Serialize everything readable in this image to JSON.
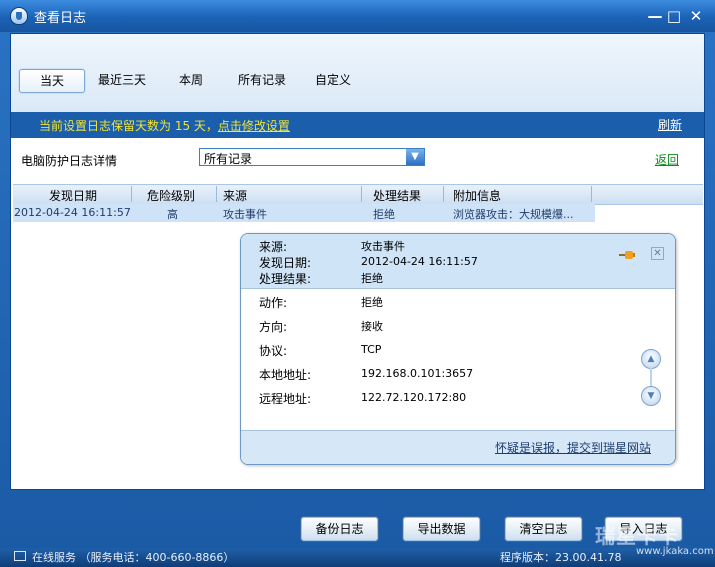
{
  "window": {
    "title": "查看日志",
    "minimize_icon": "minimize-icon",
    "maximize_icon": "maximize-icon",
    "close_icon": "close-icon"
  },
  "tabs": [
    {
      "label": "当天"
    },
    {
      "label": "最近三天"
    },
    {
      "label": "本周"
    },
    {
      "label": "所有记录"
    },
    {
      "label": "自定义"
    }
  ],
  "notice": {
    "text": "当前设置日志保留天数为 15 天，",
    "link": "点击修改设置",
    "refresh": "刷新"
  },
  "filter": {
    "label": "电脑防护日志详情",
    "value": "所有记录",
    "back": "返回"
  },
  "table": {
    "headers": [
      "发现日期",
      "危险级别",
      "来源",
      "处理结果",
      "附加信息"
    ],
    "rows": [
      {
        "date": "2012-04-24 16:11:57",
        "level": "高",
        "source": "攻击事件",
        "result": "拒绝",
        "info": "浏览器攻击：大规模爆..."
      }
    ]
  },
  "detail": {
    "head": [
      {
        "label": "来源:",
        "value": "攻击事件"
      },
      {
        "label": "发现日期:",
        "value": "2012-04-24 16:11:57"
      },
      {
        "label": "处理结果:",
        "value": "拒绝"
      }
    ],
    "fields": [
      {
        "label": "动作:",
        "value": "拒绝"
      },
      {
        "label": "方向:",
        "value": "接收"
      },
      {
        "label": "协议:",
        "value": "TCP"
      },
      {
        "label": "本地地址:",
        "value": "192.168.0.101:3657"
      },
      {
        "label": "远程地址:",
        "value": "122.72.120.172:80"
      }
    ],
    "report_link": "怀疑是误报，提交到瑞星网站"
  },
  "buttons": {
    "backup": "备份日志",
    "export": "导出数据",
    "clear": "清空日志",
    "import": "导入日志"
  },
  "statusbar": {
    "left": "在线服务 （服务电话：400-660-8866）",
    "right": "程序版本：23.00.41.78"
  },
  "watermark": {
    "logo": "瑞星卡卡",
    "url": "www.jkaka.com"
  }
}
